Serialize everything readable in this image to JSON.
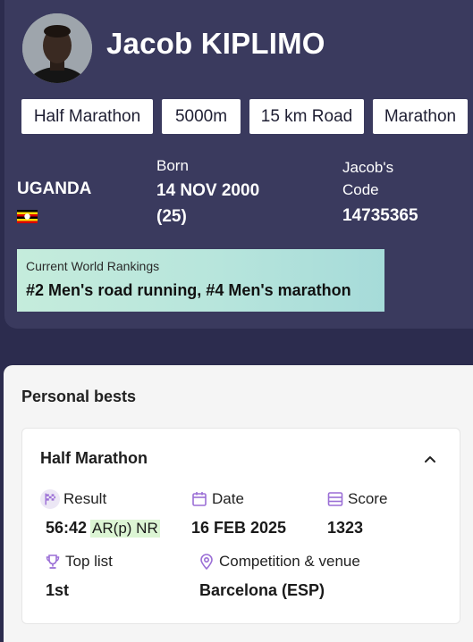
{
  "athlete": {
    "name": "Jacob KIPLIMO",
    "disciplines": [
      "Half Marathon",
      "5000m",
      "15 km Road",
      "Marathon"
    ],
    "country": "UGANDA",
    "born_label": "Born",
    "born_date": "14 NOV 2000",
    "born_age": "(25)",
    "code_label_1": "Jacob's",
    "code_label_2": "Code",
    "code": "14735365"
  },
  "rankings": {
    "label": "Current World Rankings",
    "value": "#2 Men's road running, #4 Men's marathon"
  },
  "personal_bests": {
    "title": "Personal bests",
    "card": {
      "event": "Half Marathon",
      "result_label": "Result",
      "result_value": "56:42",
      "result_badge": "AR(p) NR",
      "date_label": "Date",
      "date_value": "16 FEB 2025",
      "score_label": "Score",
      "score_value": "1323",
      "toplist_label": "Top list",
      "toplist_value": "1st",
      "venue_label": "Competition & venue",
      "venue_value": "Barcelona (ESP)"
    }
  },
  "colors": {
    "header_bg": "#3a3a5e",
    "accent_icon": "#9b6fd6",
    "record_badge_bg": "#dcf5d4",
    "ranking_gradient_start": "#c5ecdc",
    "ranking_gradient_end": "#a6dbd9"
  },
  "icons": {
    "result": "checkered-flag-icon",
    "date": "calendar-icon",
    "score": "scoreboard-icon",
    "toplist": "trophy-icon",
    "venue": "location-pin-icon",
    "collapse": "chevron-up-icon"
  }
}
